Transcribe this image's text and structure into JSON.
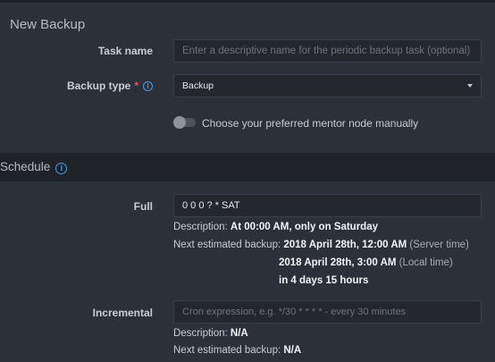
{
  "new_backup": {
    "title": "New Backup",
    "task_name": {
      "label": "Task name",
      "placeholder": "Enter a descriptive name for the periodic backup task (optional)"
    },
    "backup_type": {
      "label": "Backup type",
      "required_mark": "*",
      "info_icon": "i",
      "value": "Backup"
    },
    "mentor_toggle": {
      "label": "Choose your preferred mentor node manually",
      "on": false
    }
  },
  "schedule": {
    "title": "Schedule",
    "info_icon": "i",
    "full": {
      "label": "Full",
      "value": "0 0 0 ? * SAT",
      "description_label": "Description:",
      "description_value": "At 00:00 AM, only on Saturday",
      "next_label": "Next estimated backup:",
      "next_server_value": "2018 April 28th, 12:00 AM",
      "next_server_note": "(Server time)",
      "next_local_value": "2018 April 28th, 3:00 AM",
      "next_local_note": "(Local time)",
      "next_relative": "in 4 days 15 hours"
    },
    "incremental": {
      "label": "Incremental",
      "placeholder": "Cron expression, e.g. */30 * * * * - every 30 minutes",
      "description_label": "Description:",
      "description_value": "N/A",
      "next_label": "Next estimated backup:",
      "next_value": "N/A"
    }
  }
}
